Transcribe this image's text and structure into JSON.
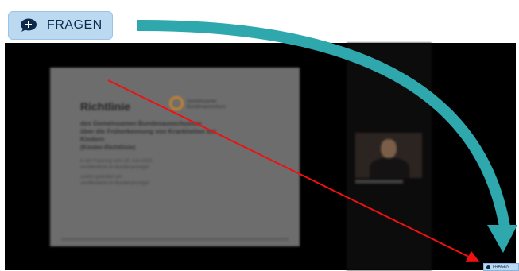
{
  "fragen_button": {
    "label": "FRAGEN",
    "icon": "chat-plus-icon",
    "bg": "#bcd9f2"
  },
  "slide": {
    "title": "Richtlinie",
    "body_lines": [
      "des Gemeinsamen Bundesausschusses",
      "über die Früherkennung von Krankheiten bei",
      "Kindern",
      "(Kinder-Richtlinie)"
    ],
    "logo_lines": [
      "Gemeinsamer",
      "Bundesausschuss"
    ],
    "sub_lines": [
      "in der Fassung vom 18. Juni 2015",
      "veröffentlicht im Bundesanzeiger",
      "zuletzt geändert am",
      "veröffentlicht im Bundesanzeiger"
    ]
  },
  "mini_fragen": {
    "label": "FRAGEN"
  },
  "annotations": {
    "red_arrow_color": "#ee1111",
    "teal_arrow_color": "#2ea7ad"
  }
}
